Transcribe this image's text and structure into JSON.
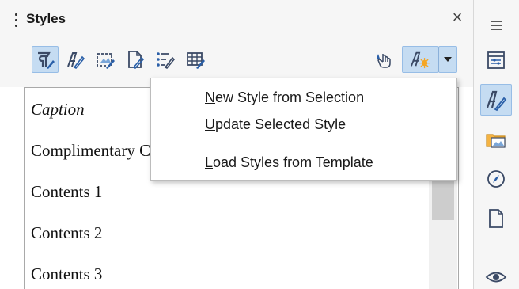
{
  "panel": {
    "title": "Styles",
    "close_symbol": "×"
  },
  "toolbar": {
    "buttons": [
      {
        "icon": "paragraph-styles-icon",
        "active": true
      },
      {
        "icon": "character-styles-icon",
        "active": false
      },
      {
        "icon": "frame-styles-icon",
        "active": false
      },
      {
        "icon": "page-styles-icon",
        "active": false
      },
      {
        "icon": "list-styles-icon",
        "active": false
      },
      {
        "icon": "table-styles-icon",
        "active": false
      },
      {
        "icon": "fill-format-mode-icon",
        "active": false
      }
    ],
    "new_style_icon": "new-style-from-selection-icon",
    "accent": "#c5dcf2"
  },
  "style_list": [
    {
      "label": "Caption",
      "italic": true
    },
    {
      "label": "Complimentary Close",
      "italic": false
    },
    {
      "label": "Contents 1",
      "italic": false
    },
    {
      "label": "Contents 2",
      "italic": false
    },
    {
      "label": "Contents 3",
      "italic": false
    }
  ],
  "menu": {
    "items": [
      {
        "accel": "N",
        "rest": "ew Style from Selection"
      },
      {
        "accel": "U",
        "rest": "pdate Selected Style"
      },
      {
        "accel": "L",
        "rest": "oad Styles from Template"
      }
    ]
  },
  "sidebar_tabs": [
    {
      "icon": "menu-icon"
    },
    {
      "icon": "properties-icon"
    },
    {
      "icon": "styles-icon"
    },
    {
      "icon": "gallery-icon"
    },
    {
      "icon": "navigator-icon"
    },
    {
      "icon": "page-icon"
    },
    {
      "icon": "manage-changes-icon"
    }
  ]
}
